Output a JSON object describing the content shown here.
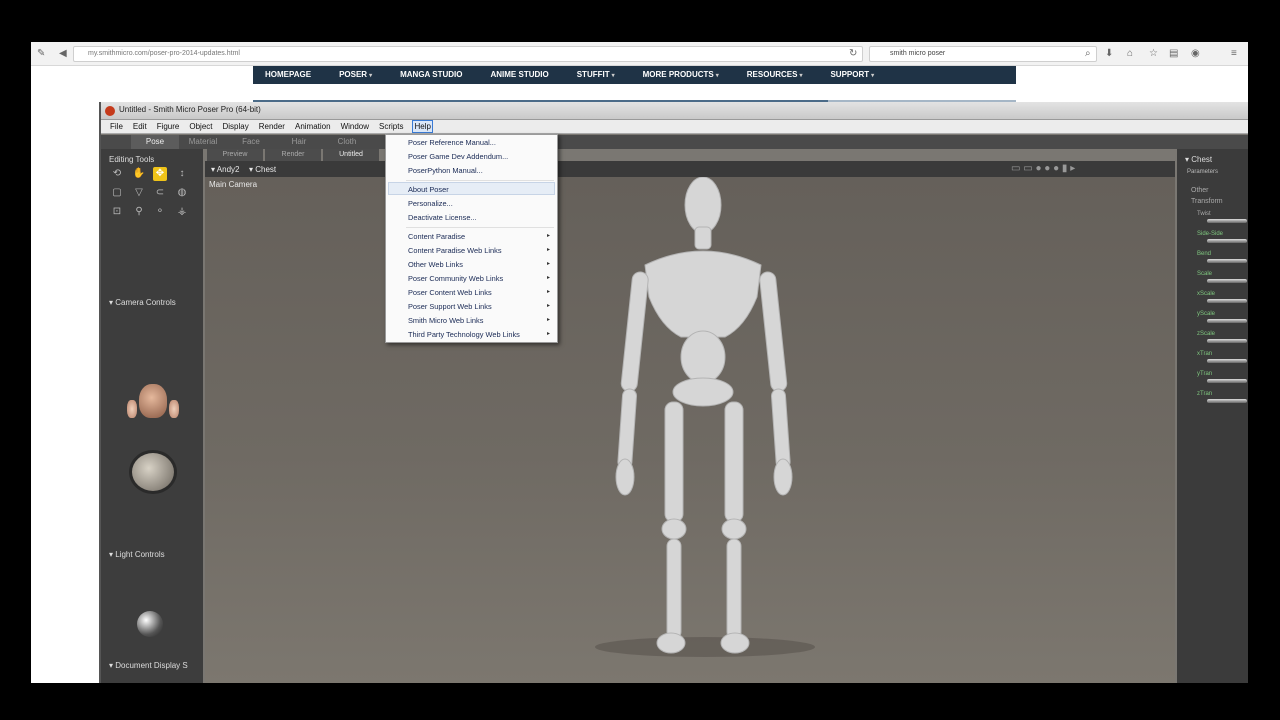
{
  "browser": {
    "url": "my.smithmicro.com/poser-pro-2014-updates.html",
    "search": "smith micro poser"
  },
  "site_nav": [
    "HOMEPAGE",
    "POSER",
    "MANGA STUDIO",
    "ANIME STUDIO",
    "STUFFIT",
    "MORE PRODUCTS",
    "RESOURCES",
    "SUPPORT"
  ],
  "poser": {
    "title": "Untitled - Smith Micro Poser Pro  (64-bit)",
    "menus": [
      "File",
      "Edit",
      "Figure",
      "Object",
      "Display",
      "Render",
      "Animation",
      "Window",
      "Scripts",
      "Help"
    ],
    "rooms": [
      "Pose",
      "Material",
      "Face",
      "Hair",
      "Cloth",
      "Fi"
    ],
    "editing_tools_label": "Editing Tools",
    "camera_controls_label": "Camera Controls",
    "light_controls_label": "Light Controls",
    "document_display_label": "Document Display S",
    "viewport_tabs": [
      "Preview",
      "Render",
      "Untitled"
    ],
    "figure_select": "Andy2",
    "actor_select": "Chest",
    "camera_name": "Main Camera",
    "right_title": "Chest",
    "right_tab": "Parameters",
    "right_groups": [
      "Other",
      "Transform"
    ],
    "params": [
      "Twist",
      "Side-Side",
      "Bend",
      "Scale",
      "xScale",
      "yScale",
      "zScale",
      "xTran",
      "yTran",
      "zTran"
    ]
  },
  "help_menu": {
    "items": [
      {
        "label": "Poser Reference Manual...",
        "submenu": false
      },
      {
        "label": "Poser Game Dev Addendum...",
        "submenu": false
      },
      {
        "label": "PoserPython Manual...",
        "submenu": false
      },
      {
        "label": "About Poser",
        "submenu": false
      },
      {
        "label": "Personalize...",
        "submenu": false
      },
      {
        "label": "Deactivate License...",
        "submenu": false
      },
      {
        "label": "Content Paradise",
        "submenu": true
      },
      {
        "label": "Content Paradise Web Links",
        "submenu": true
      },
      {
        "label": "Other Web Links",
        "submenu": true
      },
      {
        "label": "Poser Community Web Links",
        "submenu": true
      },
      {
        "label": "Poser Content Web Links",
        "submenu": true
      },
      {
        "label": "Poser Support Web Links",
        "submenu": true
      },
      {
        "label": "Smith Micro Web Links",
        "submenu": true
      },
      {
        "label": "Third Party Technology Web Links",
        "submenu": true
      }
    ],
    "highlighted": "About Poser"
  },
  "colors": {
    "nav_bg": "#1f3346",
    "selected_tool": "#f0c419",
    "figure": "#d8d8d8"
  }
}
